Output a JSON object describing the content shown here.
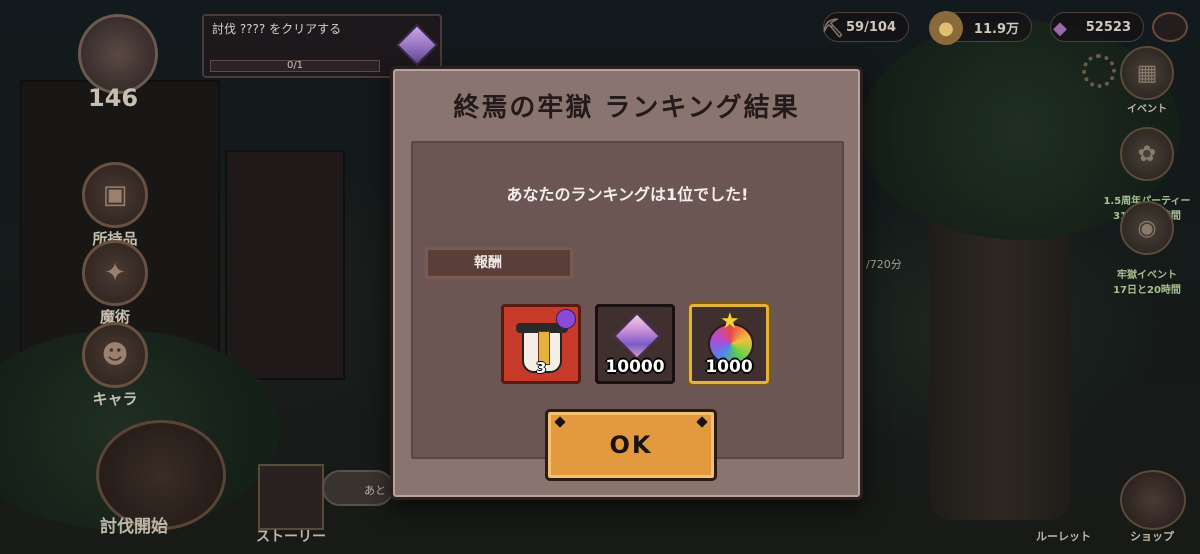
{
  "hud": {
    "quest_text": "討伐 ???? をクリアする",
    "quest_progress": "0/1",
    "level": "146",
    "stamina": "59/104",
    "gold": "11.9万",
    "gems": "52523"
  },
  "left_menu": [
    {
      "label": "所持品",
      "icon": "bag-icon"
    },
    {
      "label": "魔術",
      "icon": "magic-icon"
    },
    {
      "label": "キャラ",
      "icon": "character-icon"
    }
  ],
  "right_menu": [
    {
      "label": "イベント",
      "icon": "calendar-icon"
    },
    {
      "label": "1.5周年パーティー\n31日と20時間",
      "icon": "party-icon"
    },
    {
      "label": "牢獄イベント\n17日と20時間",
      "icon": "prison-event-icon"
    }
  ],
  "bottom": {
    "subjugation": "討伐開始",
    "story": "ストーリー",
    "roulette": "ルーレット",
    "shop": "ショップ",
    "map_count": "/720分",
    "bubble": "あと"
  },
  "modal": {
    "title": "終焉の牢獄 ランキング結果",
    "result": "あなたのランキングは1位でした!",
    "reward_label": "報酬",
    "rewards": [
      {
        "name": "character-hat",
        "qty": "3"
      },
      {
        "name": "gem",
        "qty": "10000"
      },
      {
        "name": "rainbow-bag",
        "qty": "1000"
      }
    ],
    "ok_label": "OK"
  },
  "colors": {
    "modal_bg": "#8a7470",
    "modal_body": "#6b5654",
    "ok_button": "#e39a3e",
    "selected_border": "#e3b23a"
  }
}
